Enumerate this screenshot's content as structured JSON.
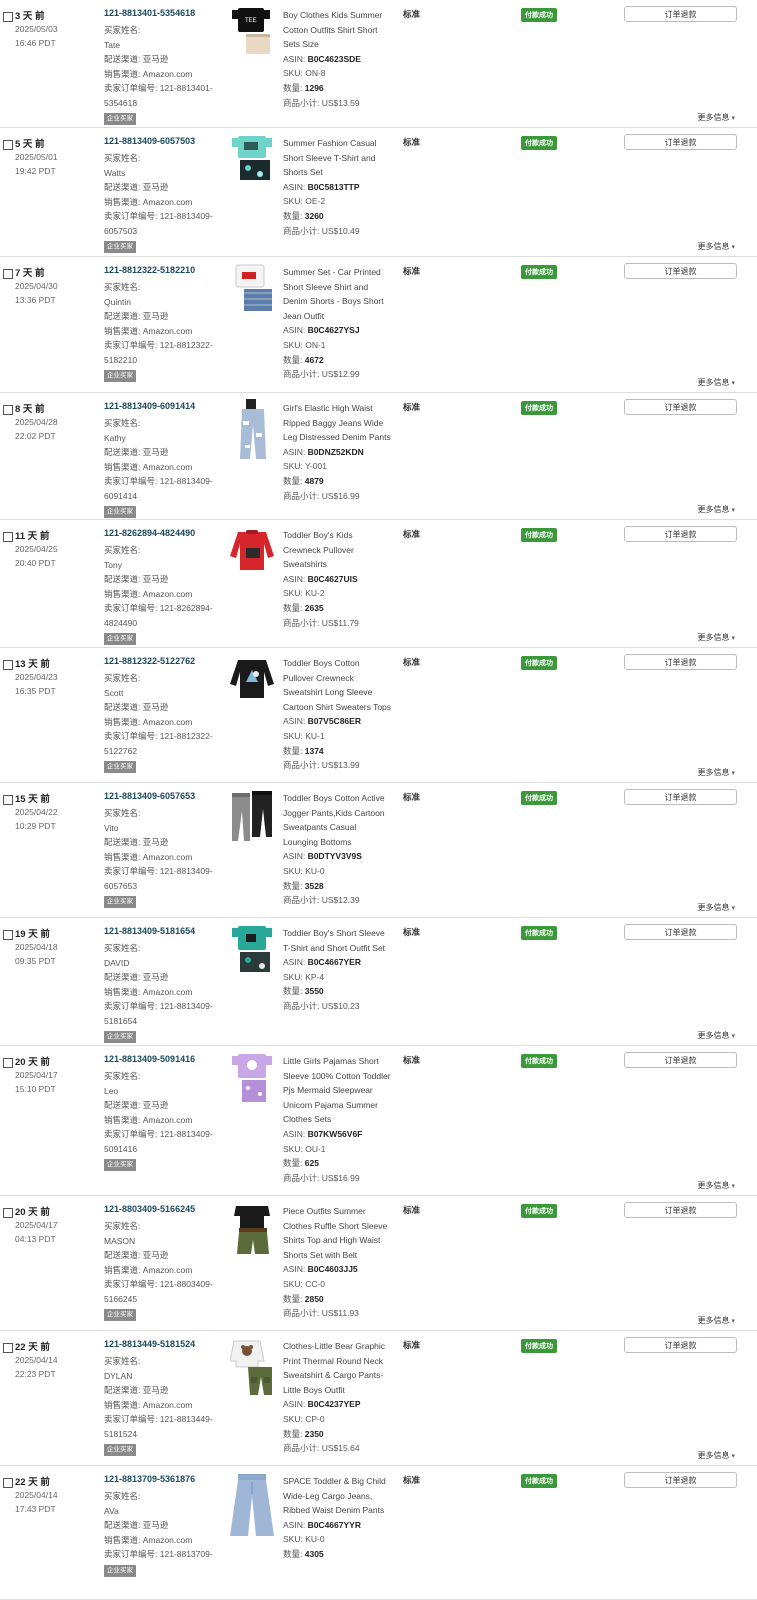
{
  "labels": {
    "buyer_name": "买家姓名:",
    "shipping_channel": "配送渠道: 亚马逊",
    "sales_channel": "销售渠道: Amazon.com",
    "seller_order_id": "卖家订单编号: ",
    "b2b": "企业买家",
    "asin": "ASIN: ",
    "sku": "SKU: ",
    "qty": "数量: ",
    "subtotal": "商品小计: ",
    "shipping_type": "标准",
    "status": "付款成功",
    "refund_button": "订单退款",
    "more_info": "更多信息"
  },
  "orders": [
    {
      "days": "3 天 前",
      "date": "2025/05/03",
      "time": "16:46 PDT",
      "order_id": "121-8813401-5354618",
      "buyer": "Tate",
      "seller_id_line1": "121-8813401-",
      "seller_id_line2": "5354618",
      "title_lines": [
        "Boy Clothes Kids Summer",
        "Cotton Outfits Shirt Short",
        "Sets Size"
      ],
      "asin": "B0C4623SDE",
      "sku": "ON-8",
      "qty": "1296",
      "subtotal": "US$13.59",
      "thumb": "shirt-black-shorts"
    },
    {
      "days": "5 天 前",
      "date": "2025/05/01",
      "time": "19:42 PDT",
      "order_id": "121-8813409-6057503",
      "buyer": "Watts",
      "seller_id_line1": "121-8813409-",
      "seller_id_line2": "6057503",
      "title_lines": [
        "Summer Fashion Casual",
        "Short Sleeve T-Shirt and",
        "Shorts Set"
      ],
      "asin": "B0C5813TTP",
      "sku": "OE-2",
      "qty": "3260",
      "subtotal": "US$10.49",
      "thumb": "shirt-teal-shorts"
    },
    {
      "days": "7 天 前",
      "date": "2025/04/30",
      "time": "13:36 PDT",
      "order_id": "121-8812322-5182210",
      "buyer": "Quintin",
      "seller_id_line1": "121-8812322-",
      "seller_id_line2": "5182210",
      "title_lines": [
        "Summer Set - Car Printed",
        "Short Sleeve Shirt and",
        "Denim Shorts - Boys Short",
        "Jean Outfit"
      ],
      "asin": "B0C4627YSJ",
      "sku": "ON-1",
      "qty": "4672",
      "subtotal": "US$12.99",
      "thumb": "shirt-white-denim"
    },
    {
      "days": "8 天 前",
      "date": "2025/04/28",
      "time": "22:02 PDT",
      "order_id": "121-8813409-6091414",
      "buyer": "Kathy",
      "seller_id_line1": "121-8813409-",
      "seller_id_line2": "6091414",
      "title_lines": [
        "Girl's Elastic High Waist",
        "Ripped Baggy Jeans Wide",
        "Leg Distressed Denim Pants"
      ],
      "asin": "B0DNZ52KDN",
      "sku": "Y-001",
      "qty": "4879",
      "subtotal": "US$16.99",
      "thumb": "jeans"
    },
    {
      "days": "11 天 前",
      "date": "2025/04/25",
      "time": "20:40 PDT",
      "order_id": "121-8262894-4824490",
      "buyer": "Tony",
      "seller_id_line1": "121-8262894-",
      "seller_id_line2": "4824490",
      "title_lines": [
        "Toddler Boy's Kids",
        "Crewneck Pullover",
        "Sweatshirts"
      ],
      "asin": "B0C4627UIS",
      "sku": "KU-2",
      "qty": "2635",
      "subtotal": "US$11.79",
      "thumb": "sweatshirt-red"
    },
    {
      "days": "13 天 前",
      "date": "2025/04/23",
      "time": "16:35 PDT",
      "order_id": "121-8812322-5122762",
      "buyer": "Scott",
      "seller_id_line1": "121-8812322-",
      "seller_id_line2": "5122762",
      "title_lines": [
        "Toddler Boys Cotton",
        "Pullover Crewneck",
        "Sweatshirt Long Sleeve",
        "Cartoon Shirt Sweaters Tops"
      ],
      "asin": "B07V5C86ER",
      "sku": "KU-1",
      "qty": "1374",
      "subtotal": "US$13.99",
      "thumb": "sweatshirt-black"
    },
    {
      "days": "15 天 前",
      "date": "2025/04/22",
      "time": "10:29 PDT",
      "order_id": "121-8813409-6057653",
      "buyer": "Vito",
      "seller_id_line1": "121-8813409-",
      "seller_id_line2": "6057653",
      "title_lines": [
        "Toddler Boys Cotton Active",
        "Jogger Pants,Kids Cartoon",
        "Sweatpants Casual",
        "Lounging Bottoms"
      ],
      "asin": "B0DTYV3V9S",
      "sku": "KU-0",
      "qty": "3528",
      "subtotal": "US$12.39",
      "thumb": "joggers"
    },
    {
      "days": "19 天 前",
      "date": "2025/04/18",
      "time": "09:35 PDT",
      "order_id": "121-8813409-5181654",
      "buyer": "DAVID",
      "seller_id_line1": "121-8813409-",
      "seller_id_line2": "5181654",
      "title_lines": [
        "Toddler Boy's Short Sleeve",
        "T-Shirt and Short Outfit Set"
      ],
      "asin": "B0C4667YER",
      "sku": "KP-4",
      "qty": "3550",
      "subtotal": "US$10.23",
      "thumb": "shirt-green-shorts"
    },
    {
      "days": "20 天 前",
      "date": "2025/04/17",
      "time": "15:10 PDT",
      "order_id": "121-8813409-5091416",
      "buyer": "Leo",
      "seller_id_line1": "121-8813409-",
      "seller_id_line2": "5091416",
      "title_lines": [
        "Little Girls Pajamas Short",
        "Sleeve 100% Cotton Toddler",
        "Pjs Mermaid Sleepwear",
        "Unicorn Pajama Summer",
        "Clothes Sets"
      ],
      "asin": "B07KW56V6F",
      "sku": "OU-1",
      "qty": "625",
      "subtotal": "US$16.99",
      "thumb": "pajama-purple"
    },
    {
      "days": "20 天 前",
      "date": "2025/04/17",
      "time": "04:13 PDT",
      "order_id": "121-8803409-5166245",
      "buyer": "MASON",
      "seller_id_line1": "121-8803409-",
      "seller_id_line2": "5166245",
      "title_lines": [
        "Piece Outfits Summer",
        "Clothes Ruffle Short Sleeve",
        "Shirts Top and High Waist",
        "Shorts Set with Belt"
      ],
      "asin": "B0C4603JJ5",
      "sku": "CC-0",
      "qty": "2850",
      "subtotal": "US$11.93",
      "thumb": "ruffle-olive"
    },
    {
      "days": "22 天 前",
      "date": "2025/04/14",
      "time": "22:23 PDT",
      "order_id": "121-8813449-5181524",
      "buyer": "DYLAN",
      "seller_id_line1": "121-8813449-",
      "seller_id_line2": "5181524",
      "title_lines": [
        "Clothes-Little Bear Graphic",
        "Print Thermal Round Neck",
        "Sweatshirt & Cargo Pants-",
        "Little Boys Outfit"
      ],
      "asin": "B0C4237YEP",
      "sku": "CP-0",
      "qty": "2350",
      "subtotal": "US$15.64",
      "thumb": "bear-cargo"
    },
    {
      "days": "22 天 前",
      "date": "2025/04/14",
      "time": "17:43 PDT",
      "order_id": "121-8813709-5361876",
      "buyer": "AVa",
      "seller_id_line1": "121-8813709-",
      "seller_id_line2": "",
      "title_lines": [
        "SPACE Toddler & Big Child",
        "Wide-Leg Cargo Jeans,",
        "Ribbed Waist Denim Pants"
      ],
      "asin": "B0C4667YYR",
      "sku": "KU-0",
      "qty": "4305",
      "subtotal": "",
      "thumb": "wide-jeans"
    }
  ]
}
